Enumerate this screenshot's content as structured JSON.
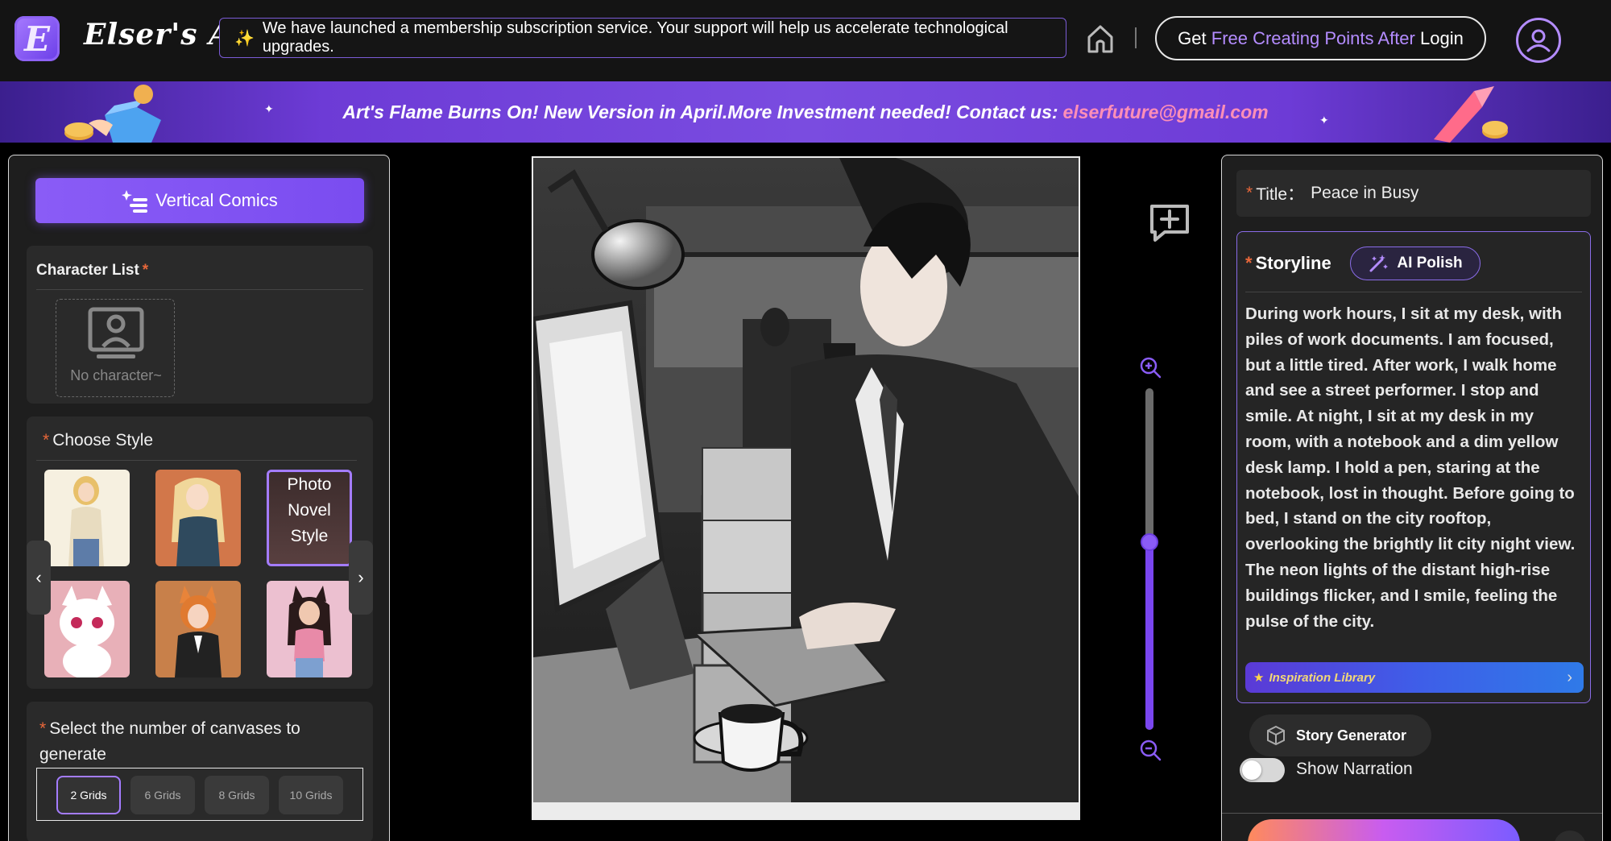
{
  "header": {
    "brand": "Elser's AI",
    "notice_icon": "sparkles-icon",
    "notice": "We have launched a membership subscription service. Your support will help us accelerate technological upgrades.",
    "login_pre": "Get",
    "login_hl": "Free Creating Points After",
    "login_post": "Login"
  },
  "banner": {
    "text": "Art's Flame Burns On! New Version in April.More Investment needed! Contact us:",
    "email": "elserfuture@gmail.com"
  },
  "left": {
    "vertical_comics": "Vertical Comics",
    "character_list": "Character List",
    "required_mark": "*",
    "no_character": "No character~",
    "choose_style": "Choose Style",
    "styles": [
      {
        "label": ""
      },
      {
        "label": ""
      },
      {
        "label": "Photo Novel Style"
      },
      {
        "label": ""
      },
      {
        "label": ""
      },
      {
        "label": ""
      }
    ],
    "grid_title": "Select the number of canvases to generate",
    "grid_options": [
      "2 Grids",
      "6 Grids",
      "8 Grids",
      "10 Grids"
    ],
    "grid_selected": "2 Grids"
  },
  "center": {
    "zoom_level": 0.55
  },
  "right": {
    "title_label": "Title：",
    "title_value": "Peace in Busy",
    "storyline_label": "Storyline",
    "ai_polish": "AI Polish",
    "storyline": "During work hours, I sit at my desk, with piles of work documents. I am focused, but a little tired. After work, I walk home and see a street performer. I stop and smile. At night, I sit at my desk in my room, with a notebook and a dim yellow desk lamp. I hold a pen, staring at the notebook, lost in thought. Before going to bed, I stand on the city rooftop, overlooking the brightly lit city night view. The neon lights of the distant high-rise buildings flicker, and I smile, feeling the pulse of the city.",
    "inspiration": "Inspiration Library",
    "story_generator": "Story Generator",
    "show_narration": "Show Narration",
    "show_narration_on": false
  },
  "colors": {
    "accent": "#8a5cf6",
    "required": "#e8673a",
    "email": "#ff8fb7"
  }
}
